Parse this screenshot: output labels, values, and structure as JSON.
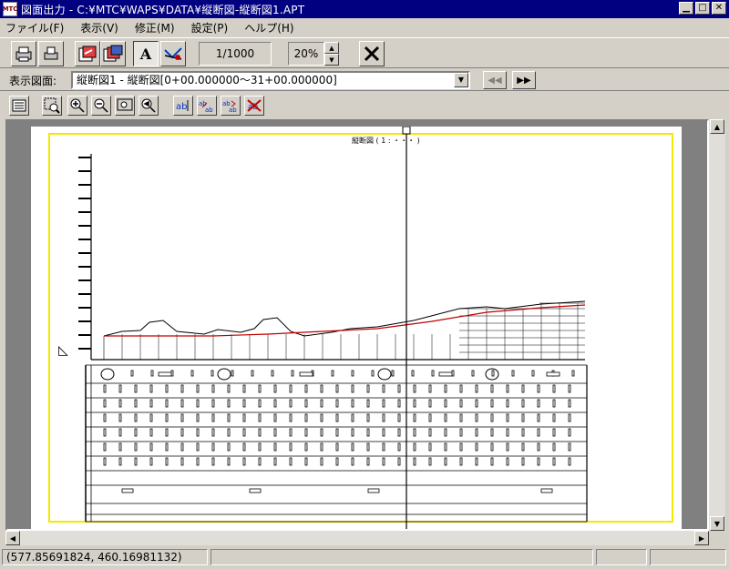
{
  "window": {
    "title": "図面出力 - C:¥MTC¥WAPS¥DATA¥縦断図-縦断図1.APT",
    "icon_label": "MTC",
    "controls": [
      "minimize-icon",
      "maximize-icon",
      "close-icon"
    ]
  },
  "menu": {
    "items": [
      "ファイル(F)",
      "表示(V)",
      "修正(M)",
      "設定(P)",
      "ヘルプ(H)"
    ]
  },
  "toolbar": {
    "buttons": [
      "print-icon",
      "print-preview-icon",
      "export-icon",
      "export-all-icon",
      "text-icon",
      "layer-icon",
      "cancel-icon"
    ],
    "text_button_label": "A",
    "scale": "1/1000",
    "zoom": "20%"
  },
  "view_select": {
    "label": "表示図面:",
    "value": "縦断図1 - 縦断図[0+00.000000～31+00.000000]",
    "prev_label": "◀◀",
    "next_label": "▶▶"
  },
  "tools": [
    "layout-icon",
    "zoom-window-icon",
    "zoom-in-icon",
    "zoom-out-icon",
    "zoom-fit-icon",
    "zoom-prev-icon",
    "text-edit-icon",
    "text-move-icon",
    "text-replace-icon",
    "text-delete-icon"
  ],
  "drawing": {
    "title": "縦断図 ( 1 : ・・・ )"
  },
  "status": {
    "coordinates": "(577.85691824, 460.16981132)"
  },
  "colors": {
    "titlebar": "#000080",
    "paper_border": "#f5e800",
    "profile_line": "#c00000"
  }
}
